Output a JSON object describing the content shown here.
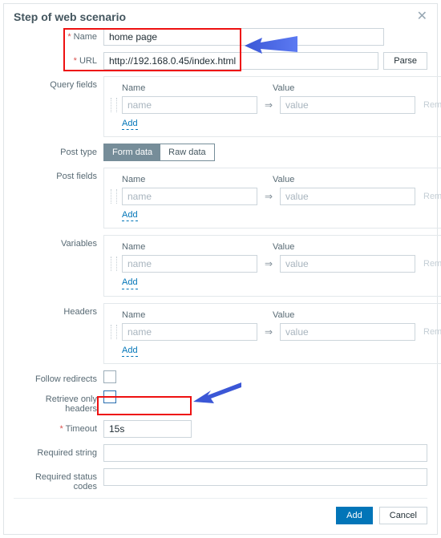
{
  "dialog": {
    "title": "Step of web scenario"
  },
  "name": {
    "label": "Name",
    "value": "home page"
  },
  "url": {
    "label": "URL",
    "value": "http://192.168.0.45/index.html",
    "parse_btn": "Parse"
  },
  "kv_common": {
    "name_header": "Name",
    "value_header": "Value",
    "name_ph": "name",
    "value_ph": "value",
    "remove": "Remove",
    "add": "Add"
  },
  "query_fields": {
    "label": "Query fields"
  },
  "post_type": {
    "label": "Post type",
    "opt1": "Form data",
    "opt2": "Raw data"
  },
  "post_fields": {
    "label": "Post fields"
  },
  "variables": {
    "label": "Variables"
  },
  "headers": {
    "label": "Headers"
  },
  "follow_redirects": {
    "label": "Follow redirects"
  },
  "retrieve_headers": {
    "label": "Retrieve only headers"
  },
  "timeout": {
    "label": "Timeout",
    "value": "15s"
  },
  "required_string": {
    "label": "Required string",
    "value": ""
  },
  "required_codes": {
    "label": "Required status codes",
    "value": ""
  },
  "footer": {
    "add": "Add",
    "cancel": "Cancel"
  }
}
